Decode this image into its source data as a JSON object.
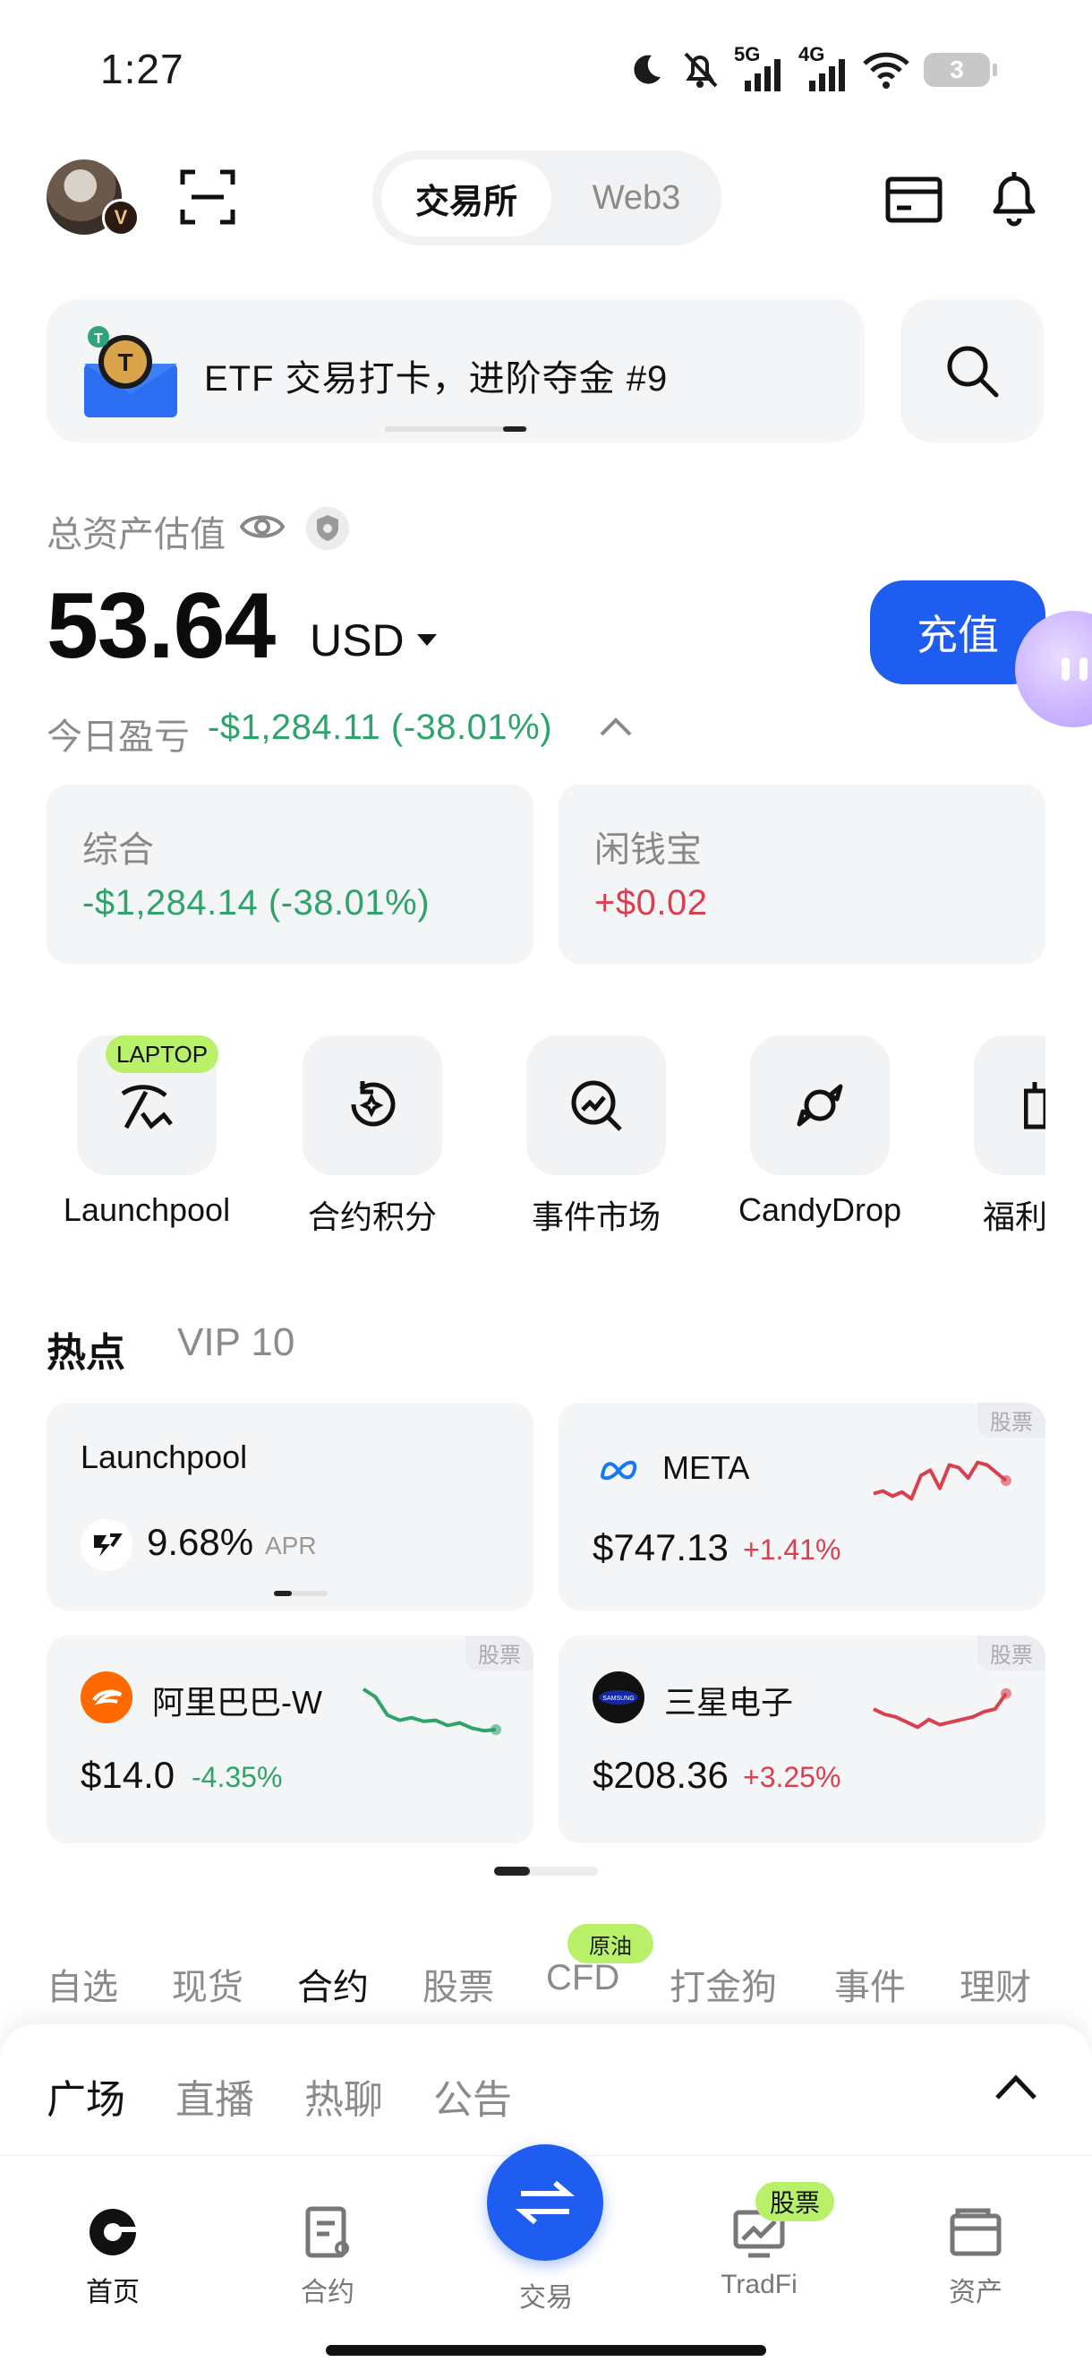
{
  "status_bar": {
    "time": "1:27",
    "network_5g": "5G",
    "network_4g": "4G",
    "battery": "3"
  },
  "header": {
    "segments": [
      "交易所",
      "Web3"
    ],
    "active_segment": "交易所",
    "vip_letter": "V"
  },
  "banner": {
    "text": "ETF 交易打卡，进阶夺金 #9"
  },
  "assets": {
    "label": "总资产估值",
    "value": "53.64",
    "currency": "USD",
    "deposit_label": "充值",
    "pnl_label": "今日盈亏",
    "pnl_value": "-$1,284.11 (-38.01%)"
  },
  "stat_cards": [
    {
      "title": "综合",
      "value": "-$1,284.14 (-38.01%)",
      "color": "#2ea46a"
    },
    {
      "title": "闲钱宝",
      "value": "+$0.02",
      "color": "#d9404f"
    }
  ],
  "shortcuts": [
    {
      "label": "Launchpool",
      "icon": "pickaxe-icon",
      "badge": "LAPTOP"
    },
    {
      "label": "合约积分",
      "icon": "points-icon"
    },
    {
      "label": "事件市场",
      "icon": "event-market-icon"
    },
    {
      "label": "CandyDrop",
      "icon": "candy-icon"
    },
    {
      "label": "福利",
      "icon": "gift-icon"
    }
  ],
  "hot": {
    "tabs": [
      "热点",
      "VIP 10"
    ],
    "cards": [
      {
        "name": "Launchpool",
        "value": "9.68%",
        "suffix": "APR"
      },
      {
        "name": "META",
        "price": "$747.13",
        "change": "+1.41%",
        "tag": "股票",
        "trend": [
          0.25,
          0.3,
          0.2,
          0.28,
          0.15,
          0.6,
          0.7,
          0.35,
          0.8,
          0.75,
          0.55,
          0.85,
          0.8,
          0.65,
          0.5
        ]
      },
      {
        "name": "阿里巴巴-W",
        "price": "$14.0",
        "change": "-4.35%",
        "tag": "股票",
        "trend": [
          0.9,
          0.75,
          0.4,
          0.3,
          0.35,
          0.28,
          0.3,
          0.2,
          0.25,
          0.15,
          0.1,
          0.12
        ]
      },
      {
        "name": "三星电子",
        "price": "$208.36",
        "change": "+3.25%",
        "tag": "股票",
        "trend": [
          0.55,
          0.45,
          0.4,
          0.3,
          0.2,
          0.35,
          0.25,
          0.3,
          0.35,
          0.4,
          0.5,
          0.55,
          0.85
        ]
      }
    ]
  },
  "market_tabs": [
    "自选",
    "现货",
    "合约",
    "股票",
    "CFD",
    "打金狗",
    "事件",
    "理财"
  ],
  "market_active": "合约",
  "oil_badge": "原油",
  "sheet_tabs": [
    "广场",
    "直播",
    "热聊",
    "公告"
  ],
  "nav": [
    {
      "label": "首页",
      "icon": "home-icon"
    },
    {
      "label": "合约",
      "icon": "contract-icon"
    },
    {
      "label": "交易",
      "icon": "trade-icon"
    },
    {
      "label": "TradFi",
      "icon": "tradfi-icon",
      "badge": "股票"
    },
    {
      "label": "资产",
      "icon": "wallet-icon"
    }
  ],
  "colors": {
    "accent": "#1f5cf0",
    "up": "#d9404f",
    "down": "#2ea46a",
    "badge": "#b8f06a"
  }
}
